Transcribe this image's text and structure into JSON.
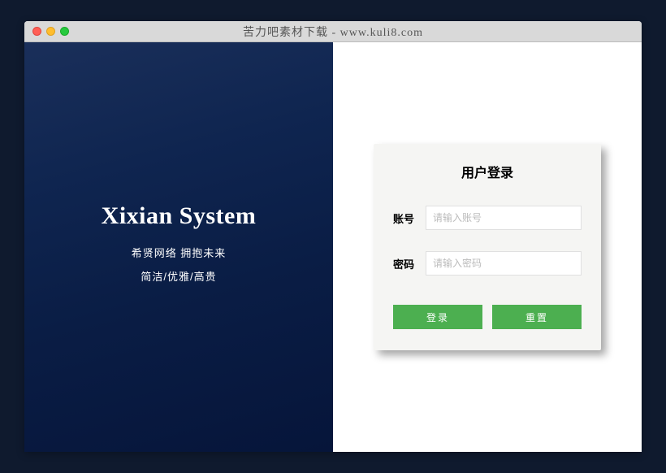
{
  "window": {
    "title": "苦力吧素材下载 - www.kuli8.com"
  },
  "brand": {
    "title": "Xixian System",
    "subtitle1": "希贤网络 拥抱未来",
    "subtitle2": "简洁/优雅/高贵"
  },
  "login": {
    "title": "用户登录",
    "username_label": "账号",
    "username_placeholder": "请输入账号",
    "password_label": "密码",
    "password_placeholder": "请输入密码",
    "login_button": "登录",
    "reset_button": "重置"
  }
}
